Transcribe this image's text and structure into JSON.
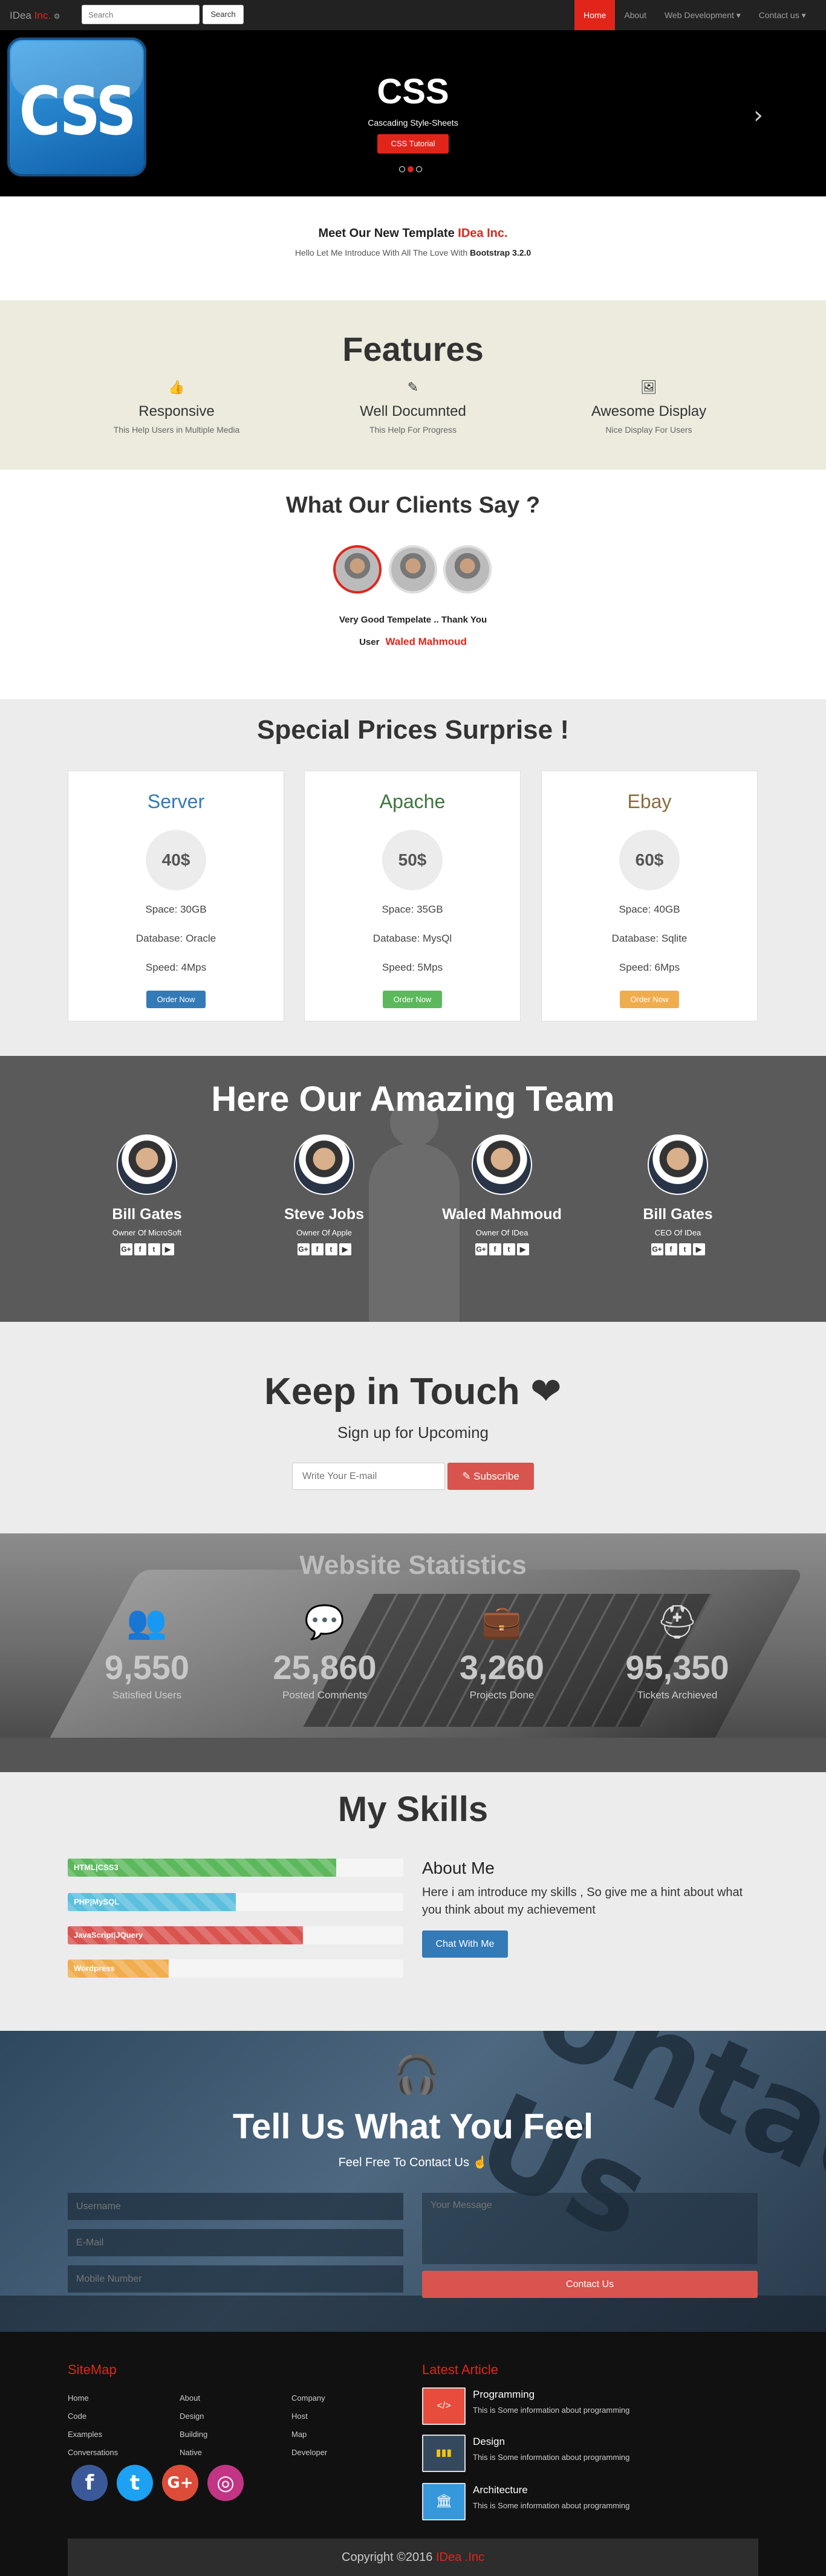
{
  "nav": {
    "brand": "IDea",
    "brand_red": "Inc.",
    "search_placeholder": "Search",
    "search_button": "Search",
    "items": [
      "Home",
      "About",
      "Web Development ▾",
      "Contact us ▾"
    ]
  },
  "hero": {
    "logo_text": "CSS",
    "title": "CSS",
    "subtitle": "Cascading Style-Sheets",
    "button": "CSS Tutorial",
    "arrow": "›"
  },
  "meet": {
    "title": "Meet Our New Template",
    "title_red": "IDea Inc.",
    "text": "Hello Let Me Introduce With All The Love With",
    "text_bold": "Bootstrap 3.2.0"
  },
  "features": {
    "title": "Features",
    "items": [
      {
        "icon": "👍",
        "title": "Responsive",
        "text": "This Help Users in Multiple Media"
      },
      {
        "icon": "✎",
        "title": "Well Documnted",
        "text": "This Help For Progress"
      },
      {
        "icon": "🖼",
        "title": "Awesome Display",
        "text": "Nice Display For Users"
      }
    ]
  },
  "clients": {
    "title": "What Our Clients Say ?",
    "quote": "Very Good Tempelate .. Thank You",
    "user_label": "User",
    "user_name": "Waled Mahmoud"
  },
  "prices": {
    "title": "Special Prices Surprise !",
    "plans": [
      {
        "name": "Server",
        "price": "40$",
        "space": "Space: 30GB",
        "db": "Database: Oracle",
        "speed": "Speed: 4Mps",
        "button": "Order Now",
        "color": "#337ab7"
      },
      {
        "name": "Apache",
        "price": "50$",
        "space": "Space: 35GB",
        "db": "Database: MysQl",
        "speed": "Speed: 5Mps",
        "button": "Order Now",
        "color": "#5cb85c"
      },
      {
        "name": "Ebay",
        "price": "60$",
        "space": "Space: 40GB",
        "db": "Database: Sqlite",
        "speed": "Speed: 6Mps",
        "button": "Order Now",
        "color": "#f0ad4e"
      }
    ]
  },
  "team": {
    "title": "Here Our Amazing Team",
    "members": [
      {
        "name": "Bill Gates",
        "role": "Owner Of MicroSoft"
      },
      {
        "name": "Steve Jobs",
        "role": "Owner Of Apple"
      },
      {
        "name": "Waled Mahmoud",
        "role": "Owner Of IDea"
      },
      {
        "name": "Bill Gates",
        "role": "CEO Of IDea"
      }
    ],
    "social": [
      "G+",
      "f",
      "t",
      "▶"
    ]
  },
  "touch": {
    "title": "Keep in Touch",
    "heart": "❤",
    "subtitle": "Sign up for Upcoming",
    "email_placeholder": "Write Your E-mail",
    "button": "✎ Subscribe"
  },
  "stats": {
    "title": "Website Statistics",
    "items": [
      {
        "icon": "👥",
        "number": "9,550",
        "label": "Satisfied Users"
      },
      {
        "icon": "💬",
        "number": "25,860",
        "label": "Posted Comments"
      },
      {
        "icon": "💼",
        "number": "3,260",
        "label": "Projects Done"
      },
      {
        "icon": "⛑",
        "number": "95,350",
        "label": "Tickets Archieved"
      }
    ]
  },
  "skills": {
    "title": "My Skills",
    "bars": [
      {
        "label": "HTML|CSS3",
        "value": 80,
        "color": "#5cb85c"
      },
      {
        "label": "PHP|MySQL",
        "value": 50,
        "color": "#5bc0de"
      },
      {
        "label": "JavaScript|JQuery",
        "value": 70,
        "color": "#d9534f"
      },
      {
        "label": "Wordpress",
        "value": 30,
        "color": "#f0ad4e"
      }
    ],
    "about_title": "About Me",
    "about_text": "Here i am introduce my skills , So give me a hint about what you think about my achievement",
    "button": "Chat With Me"
  },
  "contact": {
    "title": "Tell Us What You Feel",
    "subtitle": "Feel Free To Contact Us ☝",
    "username_placeholder": "Username",
    "email_placeholder": "E-Mail",
    "mobile_placeholder": "Mobile Number",
    "message_placeholder": "Your Message",
    "button": "Contact Us",
    "headphones": "🎧"
  },
  "footer": {
    "sitemap_title": "SiteMap",
    "col1": [
      "Home",
      "Code",
      "Examples",
      "Conversations"
    ],
    "col2": [
      "About",
      "Design",
      "Building",
      "Native"
    ],
    "col3": [
      "Company",
      "Host",
      "Map",
      "Developer"
    ],
    "social": [
      {
        "label": "f",
        "color": "#3b5998"
      },
      {
        "label": "t",
        "color": "#1da1f2"
      },
      {
        "label": "G+",
        "color": "#dd4b39"
      },
      {
        "label": "◎",
        "color": "#c13584"
      }
    ],
    "articles_title": "Latest Article",
    "articles": [
      {
        "title": "Programming",
        "text": "This is Some information about programming",
        "icon": "</>"
      },
      {
        "title": "Design",
        "text": "This is Some information about programming",
        "icon": "▮▮▮"
      },
      {
        "title": "Architecture",
        "text": "This is Some information about programming",
        "icon": "🏛"
      }
    ],
    "copyright": "Copyright ©2016",
    "copyright_red": "IDea .Inc"
  }
}
